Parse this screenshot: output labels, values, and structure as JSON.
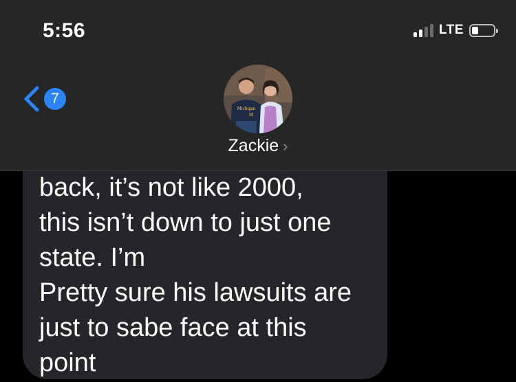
{
  "status_bar": {
    "time": "5:56",
    "network": "LTE",
    "signal_bars_filled": 2,
    "signal_bars_total": 4,
    "battery_level": 0.3
  },
  "header": {
    "back_icon": "chevron-left-icon",
    "unread_count": "7",
    "contact_name": "Zackie",
    "contact_chevron": "›",
    "avatar": "contact-photo"
  },
  "message": {
    "lines": [
      "back, it’s not like 2000,",
      "this isn’t down to just one",
      "state. I’m",
      "Pretty sure his lawsuits are",
      "just to sabe face at this",
      "point"
    ]
  },
  "colors": {
    "accent": "#2a84f7",
    "bubble": "#26252a",
    "header": "#262626",
    "background": "#000000",
    "text": "#ffffff"
  }
}
